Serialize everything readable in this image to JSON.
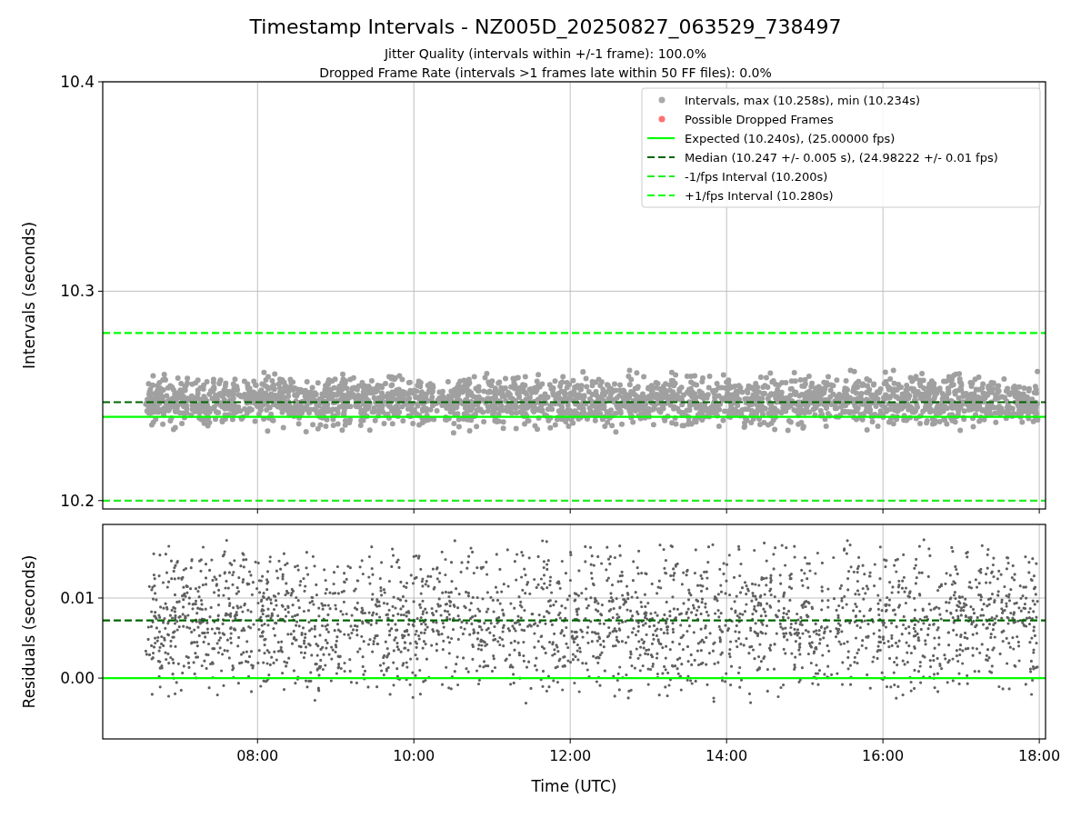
{
  "figure": {
    "title": "Timestamp Intervals - NZ005D_20250827_063529_738497",
    "subtitle_lines": [
      "Jitter Quality (intervals within +/-1 frame): 100.0%",
      "Dropped Frame Rate (intervals >1 frames late within 50 FF files): 0.0%"
    ]
  },
  "intervals_panel": {
    "legend_markers": [
      {
        "label": "Intervals, max (10.258s), min (10.234s)",
        "color": "#aaaaaa"
      },
      {
        "label": "Possible Dropped Frames",
        "color": "#ff7070"
      }
    ],
    "chart_data": {
      "type": "line",
      "ylabel": "Intervals (seconds)",
      "xlim": [
        6.02,
        18.08
      ],
      "ylim": [
        10.196,
        10.4
      ],
      "yticks": [
        10.2,
        10.3,
        10.4
      ],
      "grid": true,
      "legend": true,
      "x": [
        6.02,
        18.08
      ],
      "series": [
        {
          "name": "Expected (10.240s), (25.00000 fps)",
          "color": "#00ff00",
          "line_style": "solid",
          "values": [
            10.24,
            10.24
          ]
        },
        {
          "name": "Median (10.247 +/- 0.005 s), (24.98222 +/- 0.01 fps)",
          "color": "#006400",
          "line_style": "dashed",
          "values": [
            10.247,
            10.247
          ]
        },
        {
          "name": "-1/fps Interval (10.200s)",
          "color": "#22ee22",
          "line_style": "dashed",
          "values": [
            10.2,
            10.2
          ]
        },
        {
          "name": "+1/fps Interval (10.280s)",
          "color": "#00ff00",
          "line_style": "dashed",
          "values": [
            10.28,
            10.28
          ]
        }
      ]
    }
  },
  "residuals_panel": {
    "chart_data": {
      "type": "line",
      "xlabel": "Time (UTC)",
      "ylabel": "Residuals (seconds)",
      "xlim": [
        6.02,
        18.08
      ],
      "ylim": [
        -0.0076,
        0.0192
      ],
      "grid": true,
      "xticks": [
        {
          "value": 8,
          "label": "08:00"
        },
        {
          "value": 10,
          "label": "10:00"
        },
        {
          "value": 12,
          "label": "12:00"
        },
        {
          "value": 14,
          "label": "14:00"
        },
        {
          "value": 16,
          "label": "16:00"
        },
        {
          "value": 18,
          "label": "18:00"
        }
      ],
      "yticks": [
        {
          "value": 0,
          "label": "0.00"
        },
        {
          "value": 0.01,
          "label": "0.01"
        }
      ],
      "x": [
        6.02,
        18.08
      ],
      "series": [
        {
          "color": "#006400",
          "line_style": "dashed",
          "values": [
            0.0072,
            0.0072
          ]
        },
        {
          "color": "#00ff00",
          "line_style": "solid",
          "values": [
            0,
            0
          ]
        }
      ]
    }
  }
}
